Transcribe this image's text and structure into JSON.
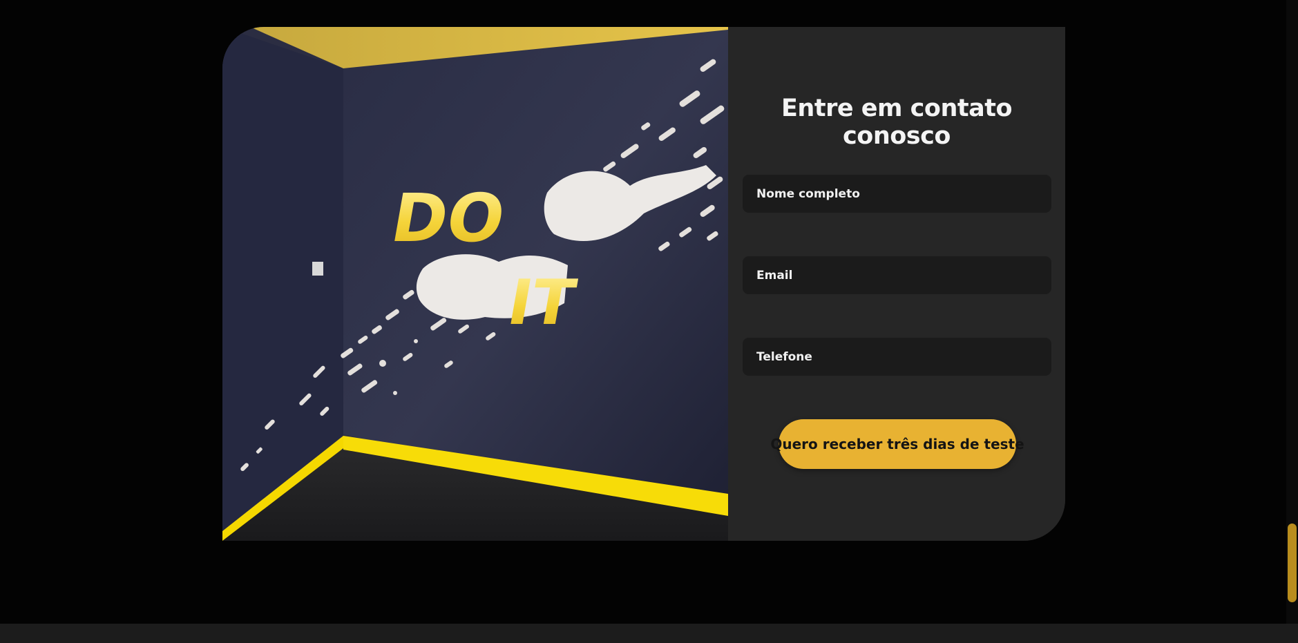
{
  "contact": {
    "title": "Entre em contato conosco",
    "fields": [
      {
        "label": "Nome completo"
      },
      {
        "label": "Email"
      },
      {
        "label": "Telefone"
      }
    ],
    "submit_label": "Quero receber três dias de teste"
  },
  "photo": {
    "mural_text_top": "DO",
    "mural_text_bottom": "IT"
  },
  "colors": {
    "background": "#030303",
    "panel": "#262626",
    "field": "#1b1b1b",
    "accent": "#e8b232"
  }
}
